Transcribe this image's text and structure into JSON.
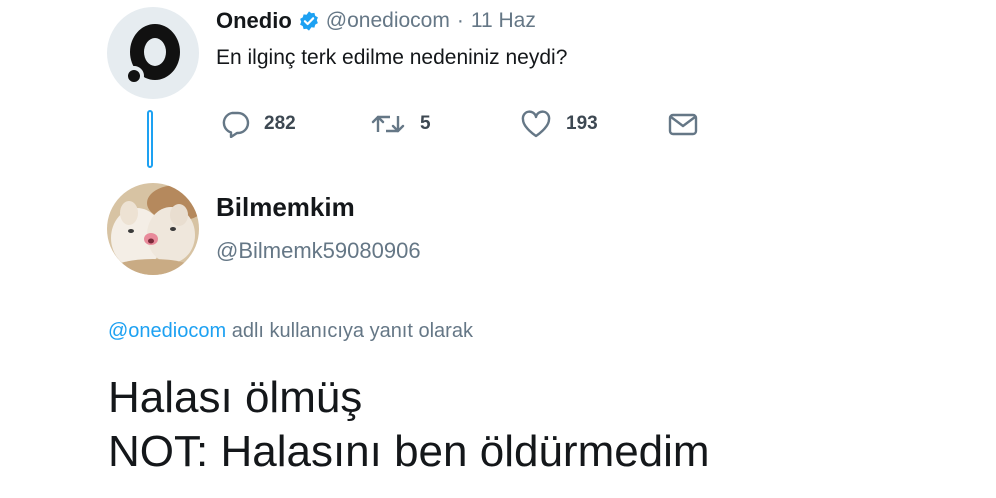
{
  "original_tweet": {
    "author_name": "Onedio",
    "author_handle": "@onediocom",
    "separator": "·",
    "date": "11 Haz",
    "text": "En ilginç terk edilme nedeniniz neydi?",
    "verified_icon": "verified-badge-icon",
    "avatar_icon": "onedio-logo",
    "actions": {
      "reply_count": "282",
      "retweet_count": "5",
      "like_count": "193"
    }
  },
  "reply_tweet": {
    "author_name": "Bilmemkim",
    "author_handle": "@Bilmemk59080906",
    "avatar_icon": "cat-avatar",
    "reply_context": {
      "mention": "@onediocom",
      "suffix": " adlı kullanıcıya yanıt olarak"
    },
    "text_lines": [
      "Halası ölmüş",
      "NOT: Halasını ben öldürmedim"
    ]
  },
  "colors": {
    "accent": "#1da1f2",
    "secondary_text": "#657786",
    "primary_text": "#14171a"
  }
}
